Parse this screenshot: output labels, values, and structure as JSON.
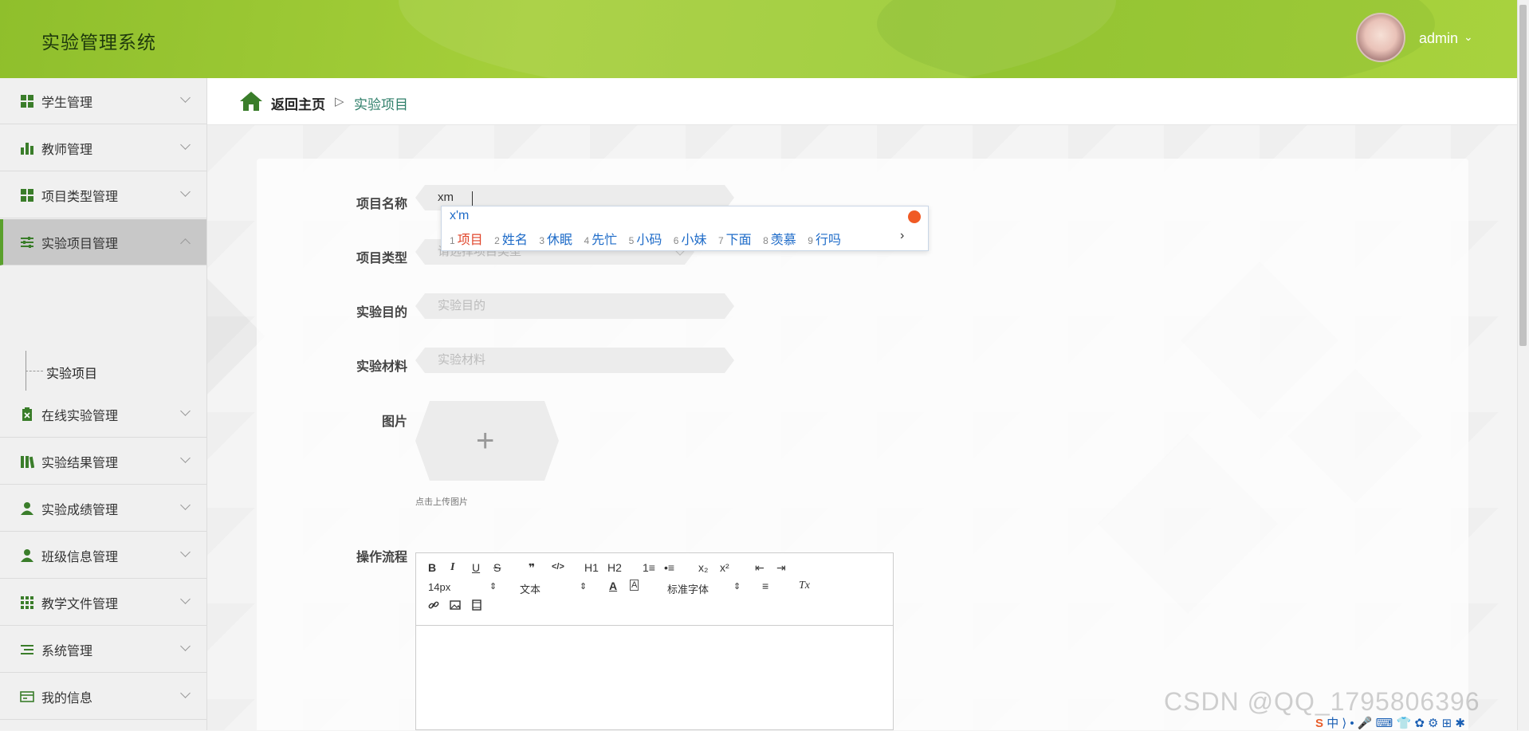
{
  "app": {
    "title": "实验管理系统",
    "user_name": "admin",
    "user_caret": "⌄"
  },
  "sidebar": {
    "items": [
      {
        "label": "学生管理",
        "icon": "grid-icon"
      },
      {
        "label": "教师管理",
        "icon": "bar-chart-icon"
      },
      {
        "label": "项目类型管理",
        "icon": "grid-icon"
      },
      {
        "label": "实验项目管理",
        "icon": "sliders-icon",
        "active": true
      },
      {
        "label": "在线实验管理",
        "icon": "clipboard-x-icon"
      },
      {
        "label": "实验结果管理",
        "icon": "books-icon"
      },
      {
        "label": "实验成绩管理",
        "icon": "user-icon"
      },
      {
        "label": "班级信息管理",
        "icon": "user-icon"
      },
      {
        "label": "教学文件管理",
        "icon": "grid-nine-icon"
      },
      {
        "label": "系统管理",
        "icon": "list-icon"
      },
      {
        "label": "我的信息",
        "icon": "id-card-icon"
      }
    ],
    "sub_item": "实验项目"
  },
  "breadcrumb": {
    "home": "返回主页",
    "separator": "▷",
    "current": "实验项目"
  },
  "form": {
    "name_label": "项目名称",
    "name_value": "xm",
    "type_label": "项目类型",
    "type_placeholder": "请选择项目类型",
    "purpose_label": "实验目的",
    "purpose_placeholder": "实验目的",
    "material_label": "实验材料",
    "material_placeholder": "实验材料",
    "image_label": "图片",
    "upload_plus": "+",
    "upload_hint": "点击上传图片",
    "procedure_label": "操作流程"
  },
  "editor": {
    "font_size": "14px",
    "block_format": "文本",
    "font_family": "标准字体",
    "buttons": [
      "B",
      "I",
      "U",
      "S",
      "❞",
      "</>",
      "H1",
      "H2",
      "1≡",
      "•≡",
      "x₂",
      "x²",
      "⇤",
      "⇥"
    ],
    "text_color": "A",
    "bg_color": "A",
    "align": "≡",
    "clear": "Tx"
  },
  "ime": {
    "input": "x'm",
    "candidates": [
      {
        "n": "1",
        "text": "项目"
      },
      {
        "n": "2",
        "text": "姓名"
      },
      {
        "n": "3",
        "text": "休眠"
      },
      {
        "n": "4",
        "text": "先忙"
      },
      {
        "n": "5",
        "text": "小码"
      },
      {
        "n": "6",
        "text": "小妹"
      },
      {
        "n": "7",
        "text": "下面"
      },
      {
        "n": "8",
        "text": "羡慕"
      },
      {
        "n": "9",
        "text": "行吗"
      }
    ],
    "more": "›"
  },
  "watermark": "CSDN @QQ_1795806396",
  "tray": {
    "logo": "S",
    "lang": "中",
    "icons": "⟩ • 🎤 ⌨ 👕 ✿ ⚙ ⊞ ✱"
  },
  "colors": {
    "header": "#9ccb34",
    "accent": "#5aa02c",
    "breadcrumb_current": "#2f7f6a",
    "ime_text": "#1e6bc8",
    "ime_selected": "#e0442a"
  }
}
